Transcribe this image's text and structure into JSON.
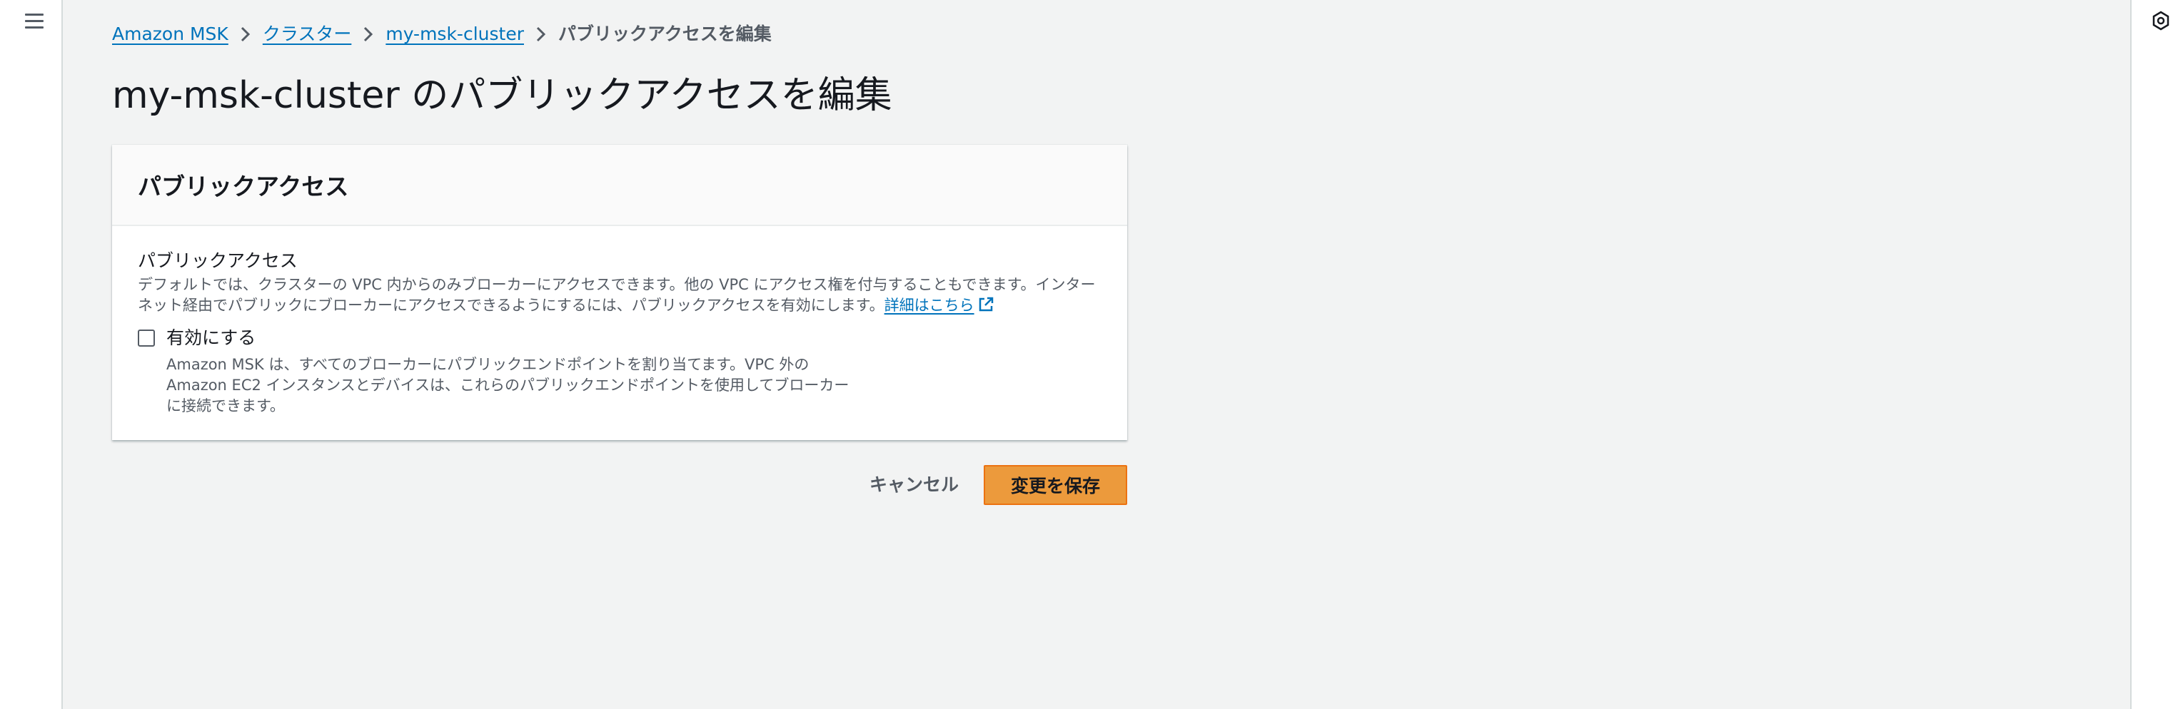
{
  "breadcrumb": {
    "items": [
      {
        "label": "Amazon MSK"
      },
      {
        "label": "クラスター"
      },
      {
        "label": "my-msk-cluster"
      }
    ],
    "current": "パブリックアクセスを編集"
  },
  "page": {
    "title": "my-msk-cluster のパブリックアクセスを編集"
  },
  "panel": {
    "header": "パブリックアクセス",
    "field_label": "パブリックアクセス",
    "description": "デフォルトでは、クラスターの VPC 内からのみブローカーにアクセスできます。他の VPC にアクセス権を付与することもできます。インターネット経由でパブリックにブローカーにアクセスできるようにするには、パブリックアクセスを有効にします。",
    "info_link": "詳細はこちら",
    "checkbox": {
      "label": "有効にする",
      "checked": false,
      "description_line1": "Amazon MSK は、すべてのブローカーにパブリックエンドポイントを割り当てます。VPC 外の",
      "description_line2": "Amazon EC2 インスタンスとデバイスは、これらのパブリックエンドポイントを使用してブローカー",
      "description_line3": "に接続できます。"
    }
  },
  "actions": {
    "cancel_label": "キャンセル",
    "save_label": "変更を保存"
  },
  "icons": {
    "menu": "hamburger-menu-icon",
    "tools": "settings-hexagon-icon",
    "separator": "chevron-right-icon",
    "external": "external-link-icon"
  },
  "colors": {
    "link": "#0073bb",
    "primary_button": "#ec9a3c",
    "background": "#f2f3f3"
  }
}
